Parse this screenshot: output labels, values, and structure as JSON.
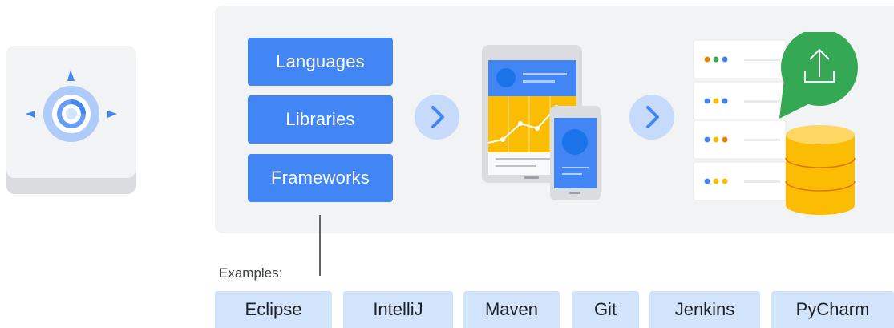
{
  "stack_buttons": [
    "Languages",
    "Libraries",
    "Frameworks"
  ],
  "examples_label": "Examples:",
  "tools": [
    "Eclipse",
    "IntelliJ",
    "Maven",
    "Git",
    "Jenkins",
    "PyCharm"
  ],
  "colors": {
    "blue": "#4285f4",
    "light_blue": "#c6dafc",
    "pill_blue": "#d2e3fc",
    "panel_gray": "#f1f3f4",
    "yellow": "#fbbc04",
    "green": "#34a853",
    "red": "#ea4335"
  },
  "icons": [
    "app-engine-icon",
    "chevron-right-icon",
    "device-app-icon",
    "server-rack-icon",
    "upload-icon",
    "database-icon"
  ]
}
